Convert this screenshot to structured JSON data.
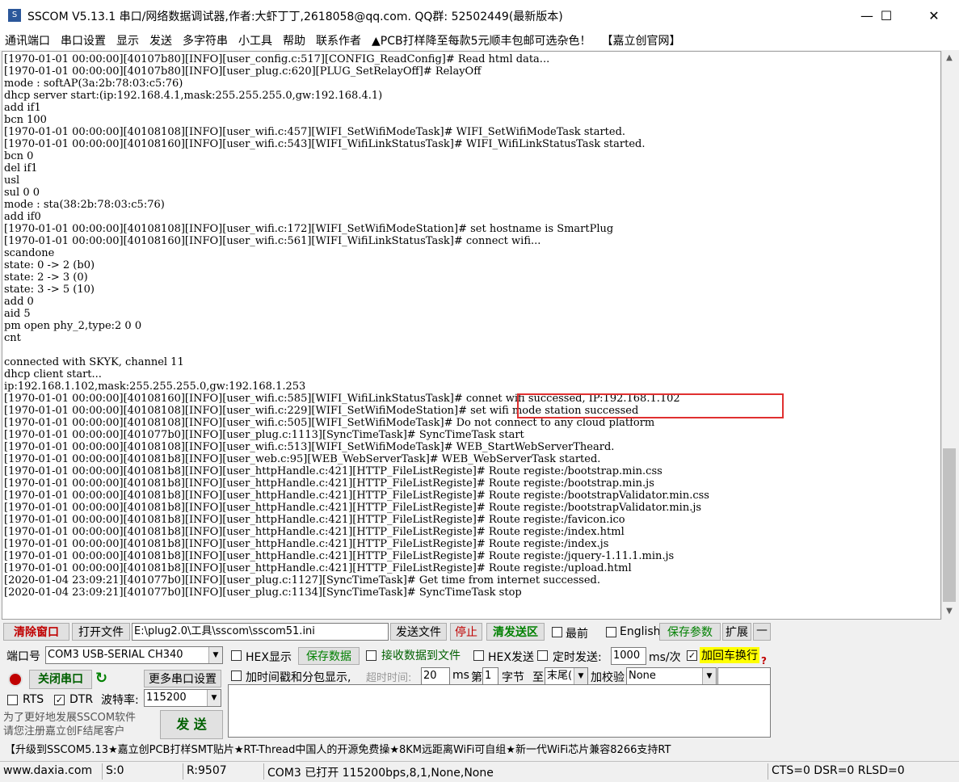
{
  "window": {
    "title": "SSCOM V5.13.1 串口/网络数据调试器,作者:大虾丁丁,2618058@qq.com. QQ群:  52502449(最新版本)",
    "icon_text": "S",
    "minimize": "—",
    "maximize": "☐",
    "close": "✕"
  },
  "menu": [
    "通讯端口",
    "串口设置",
    "显示",
    "发送",
    "多字符串",
    "小工具",
    "帮助",
    "联系作者",
    "▲PCB打样降至每款5元顺丰包邮可选杂色！",
    "【嘉立创官网】"
  ],
  "log": [
    "[1970-01-01 00:00:00][40107b80][INFO][user_config.c:517][CONFIG_ReadConfig]# Read html data...",
    "[1970-01-01 00:00:00][40107b80][INFO][user_plug.c:620][PLUG_SetRelayOff]# RelayOff",
    "mode : softAP(3a:2b:78:03:c5:76)",
    "dhcp server start:(ip:192.168.4.1,mask:255.255.255.0,gw:192.168.4.1)",
    "add if1",
    "bcn 100",
    "[1970-01-01 00:00:00][40108108][INFO][user_wifi.c:457][WIFI_SetWifiModeTask]# WIFI_SetWifiModeTask started.",
    "[1970-01-01 00:00:00][40108160][INFO][user_wifi.c:543][WIFI_WifiLinkStatusTask]# WIFI_WifiLinkStatusTask started.",
    "bcn 0",
    "del if1",
    "usl",
    "sul 0 0",
    "mode : sta(38:2b:78:03:c5:76)",
    "add if0",
    "[1970-01-01 00:00:00][40108108][INFO][user_wifi.c:172][WIFI_SetWifiModeStation]# set hostname is SmartPlug",
    "[1970-01-01 00:00:00][40108160][INFO][user_wifi.c:561][WIFI_WifiLinkStatusTask]# connect wifi...",
    "scandone",
    "state: 0 -> 2 (b0)",
    "state: 2 -> 3 (0)",
    "state: 3 -> 5 (10)",
    "add 0",
    "aid 5",
    "pm open phy_2,type:2 0 0",
    "cnt",
    "",
    "connected with SKYK, channel 11",
    "dhcp client start...",
    "ip:192.168.1.102,mask:255.255.255.0,gw:192.168.1.253",
    "[1970-01-01 00:00:00][40108160][INFO][user_wifi.c:585][WIFI_WifiLinkStatusTask]# connet wifi successed, IP:192.168.1.102",
    "[1970-01-01 00:00:00][40108108][INFO][user_wifi.c:229][WIFI_SetWifiModeStation]# set wifi mode station successed",
    "[1970-01-01 00:00:00][40108108][INFO][user_wifi.c:505][WIFI_SetWifiModeTask]# Do not connect to any cloud platform",
    "[1970-01-01 00:00:00][401077b0][INFO][user_plug.c:1113][SyncTimeTask]# SyncTimeTask start",
    "[1970-01-01 00:00:00][40108108][INFO][user_wifi.c:513][WIFI_SetWifiModeTask]# WEB_StartWebServerTheard.",
    "[1970-01-01 00:00:00][401081b8][INFO][user_web.c:95][WEB_WebServerTask]# WEB_WebServerTask started.",
    "[1970-01-01 00:00:00][401081b8][INFO][user_httpHandle.c:421][HTTP_FileListRegiste]# Route registe:/bootstrap.min.css",
    "[1970-01-01 00:00:00][401081b8][INFO][user_httpHandle.c:421][HTTP_FileListRegiste]# Route registe:/bootstrap.min.js",
    "[1970-01-01 00:00:00][401081b8][INFO][user_httpHandle.c:421][HTTP_FileListRegiste]# Route registe:/bootstrapValidator.min.css",
    "[1970-01-01 00:00:00][401081b8][INFO][user_httpHandle.c:421][HTTP_FileListRegiste]# Route registe:/bootstrapValidator.min.js",
    "[1970-01-01 00:00:00][401081b8][INFO][user_httpHandle.c:421][HTTP_FileListRegiste]# Route registe:/favicon.ico",
    "[1970-01-01 00:00:00][401081b8][INFO][user_httpHandle.c:421][HTTP_FileListRegiste]# Route registe:/index.html",
    "[1970-01-01 00:00:00][401081b8][INFO][user_httpHandle.c:421][HTTP_FileListRegiste]# Route registe:/index.js",
    "[1970-01-01 00:00:00][401081b8][INFO][user_httpHandle.c:421][HTTP_FileListRegiste]# Route registe:/jquery-1.11.1.min.js",
    "[1970-01-01 00:00:00][401081b8][INFO][user_httpHandle.c:421][HTTP_FileListRegiste]# Route registe:/upload.html",
    "[2020-01-04 23:09:21][401077b0][INFO][user_plug.c:1127][SyncTimeTask]# Get time from internet successed.",
    "[2020-01-04 23:09:21][401077b0][INFO][user_plug.c:1134][SyncTimeTask]# SyncTimeTask stop",
    ""
  ],
  "toolbar": {
    "clear": "清除窗口",
    "open_file": "打开文件",
    "file_path": "E:\\plug2.0\\工具\\sscom\\sscom51.ini",
    "send_file": "发送文件",
    "stop": "停止",
    "clear_send": "清发送区",
    "last": "最前",
    "english": "English",
    "save_params": "保存参数",
    "expand": "扩展",
    "dash": "—"
  },
  "port": {
    "label": "端口号",
    "value": "COM3 USB-SERIAL CH340",
    "close_port": "关闭串口",
    "more_settings": "更多串口设置",
    "rts": "RTS",
    "dtr": "DTR",
    "baud_label": "波特率:",
    "baud_value": "115200",
    "promo": "为了更好地发展SSCOM软件\n请您注册嘉立创F结尾客户",
    "send": "发  送"
  },
  "options": {
    "hex_display": "HEX显示",
    "save_data": "保存数据",
    "recv_to_file": "接收数据到文件",
    "hex_send": "HEX发送",
    "timed_send": "定时发送:",
    "interval": "1000",
    "interval_unit": "ms/次",
    "add_crlf": "加回车换行",
    "help": "?",
    "timestamp": "加时间戳和分包显示,",
    "timeout_label": "超时时间:",
    "timeout_value": "20",
    "ms": "ms",
    "byte_prefix": "第",
    "byte_value": "1",
    "byte_suffix": "字节",
    "to": "至",
    "to_value": "末尾(",
    "checksum": "加校验",
    "checksum_value": "None"
  },
  "ticker": "【升级到SSCOM5.13★嘉立创PCB打样SMT贴片★RT-Thread中国人的开源免费操★8KM远距离WiFi可自组★新一代WiFi芯片兼容8266支持RT",
  "status": {
    "site": "www.daxia.com",
    "sent": "S:0",
    "received": "R:9507",
    "port_state": "COM3 已打开  115200bps,8,1,None,None",
    "signals": "CTS=0 DSR=0 RLSD=0"
  },
  "colors": {
    "highlight": "#e03030",
    "red_text": "#c00000",
    "green_text": "#008000",
    "yellow": "#ffff00"
  }
}
